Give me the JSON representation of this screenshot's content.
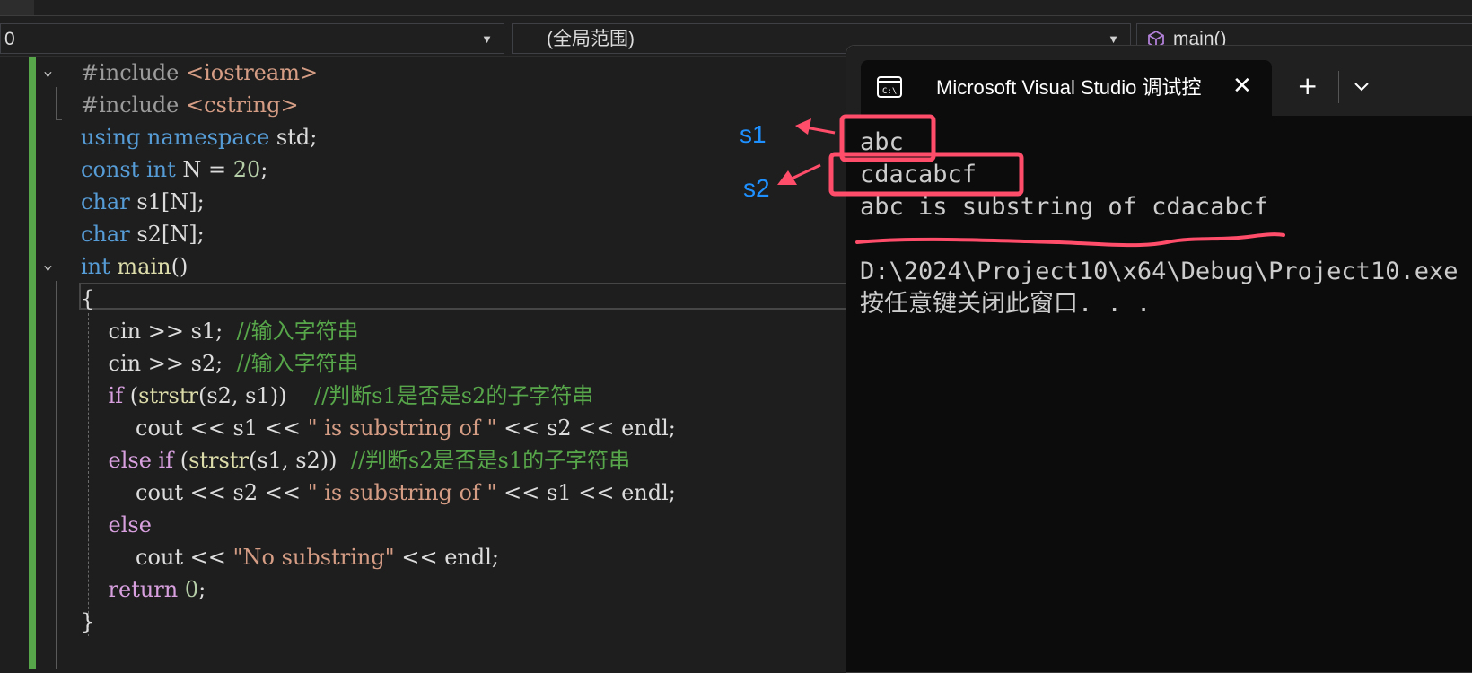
{
  "nav": {
    "project_combo": "0",
    "scope_combo": "(全局范围)",
    "member_combo": "main()"
  },
  "editor": {
    "lines": [
      [
        {
          "t": "#include ",
          "c": "pp"
        },
        {
          "t": "<iostream>",
          "c": "inc"
        }
      ],
      [
        {
          "t": "#include ",
          "c": "pp"
        },
        {
          "t": "<cstring>",
          "c": "inc"
        }
      ],
      [
        {
          "t": "using ",
          "c": "kw"
        },
        {
          "t": "namespace ",
          "c": "kw"
        },
        {
          "t": "std;",
          "c": ""
        }
      ],
      [
        {
          "t": "const ",
          "c": "kw"
        },
        {
          "t": "int ",
          "c": "kw"
        },
        {
          "t": "N = ",
          "c": ""
        },
        {
          "t": "20",
          "c": "num"
        },
        {
          "t": ";",
          "c": ""
        }
      ],
      [
        {
          "t": "char ",
          "c": "kw"
        },
        {
          "t": "s1[N];",
          "c": ""
        }
      ],
      [
        {
          "t": "char ",
          "c": "kw"
        },
        {
          "t": "s2[N];",
          "c": ""
        }
      ],
      [
        {
          "t": "int ",
          "c": "kw"
        },
        {
          "t": "main",
          "c": "fn"
        },
        {
          "t": "()",
          "c": ""
        }
      ],
      [
        {
          "t": "{",
          "c": ""
        }
      ],
      [
        {
          "t": "    cin >> s1;  ",
          "c": ""
        },
        {
          "t": "//输入字符串",
          "c": "cmt"
        }
      ],
      [
        {
          "t": "    cin >> s2;  ",
          "c": ""
        },
        {
          "t": "//输入字符串",
          "c": "cmt"
        }
      ],
      [
        {
          "t": "    ",
          "c": ""
        },
        {
          "t": "if ",
          "c": "ctl"
        },
        {
          "t": "(",
          "c": ""
        },
        {
          "t": "strstr",
          "c": "fn"
        },
        {
          "t": "(s2, s1))    ",
          "c": ""
        },
        {
          "t": "//判断s1是否是s2的子字符串",
          "c": "cmt"
        }
      ],
      [
        {
          "t": "        cout << s1 << ",
          "c": ""
        },
        {
          "t": "\" is substring of \"",
          "c": "str"
        },
        {
          "t": " << s2 << endl;",
          "c": ""
        }
      ],
      [
        {
          "t": "    ",
          "c": ""
        },
        {
          "t": "else if ",
          "c": "ctl"
        },
        {
          "t": "(",
          "c": ""
        },
        {
          "t": "strstr",
          "c": "fn"
        },
        {
          "t": "(s1, s2))  ",
          "c": ""
        },
        {
          "t": "//判断s2是否是s1的子字符串",
          "c": "cmt"
        }
      ],
      [
        {
          "t": "        cout << s2 << ",
          "c": ""
        },
        {
          "t": "\" is substring of \"",
          "c": "str"
        },
        {
          "t": " << s1 << endl;",
          "c": ""
        }
      ],
      [
        {
          "t": "    ",
          "c": ""
        },
        {
          "t": "else",
          "c": "ctl"
        }
      ],
      [
        {
          "t": "        cout << ",
          "c": ""
        },
        {
          "t": "\"No substring\"",
          "c": "str"
        },
        {
          "t": " << endl;",
          "c": ""
        }
      ],
      [
        {
          "t": "    ",
          "c": ""
        },
        {
          "t": "return ",
          "c": "ctl"
        },
        {
          "t": "0",
          "c": "num"
        },
        {
          "t": ";",
          "c": ""
        }
      ],
      [
        {
          "t": "}",
          "c": ""
        }
      ]
    ]
  },
  "annotations": {
    "s1_label": "s1",
    "s2_label": "s2",
    "highlight_color": "#ff4d6a",
    "label_color": "#1e90ff"
  },
  "console": {
    "title": "Microsoft Visual Studio 调试控",
    "close_label": "✕",
    "new_tab_label": "+",
    "output_lines": [
      "abc",
      "cdacabcf",
      "abc is substring of cdacabcf",
      "",
      "D:\\2024\\Project10\\x64\\Debug\\Project10.exe",
      "按任意键关闭此窗口. . ."
    ]
  },
  "colors": {
    "keyword": "#569cd6",
    "comment": "#57a64a",
    "string": "#d69d85",
    "function": "#dcdcaa",
    "control": "#d8a0df",
    "number": "#b5cea8",
    "editor_bg": "#1e1e1e",
    "console_bg": "#0c0c0c"
  }
}
